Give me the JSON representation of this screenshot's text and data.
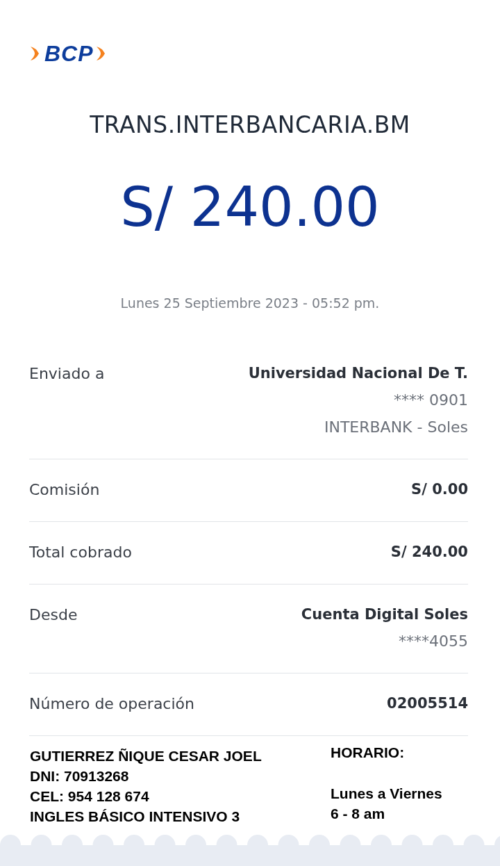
{
  "logo": {
    "text": "BCP"
  },
  "title": "TRANS.INTERBANCARIA.BM",
  "amount": "S/ 240.00",
  "datetime": "Lunes 25 Septiembre 2023 - 05:52 pm.",
  "details": [
    {
      "label": "Enviado a",
      "values": [
        "Universidad Nacional De T.",
        "**** 0901",
        "INTERBANK - Soles"
      ]
    },
    {
      "label": "Comisión",
      "values": [
        "S/ 0.00"
      ]
    },
    {
      "label": "Total cobrado",
      "values": [
        "S/ 240.00"
      ]
    },
    {
      "label": "Desde",
      "values": [
        "Cuenta Digital Soles",
        "****4055"
      ]
    },
    {
      "label": "Número de operación",
      "values": [
        "02005514"
      ]
    }
  ],
  "note": {
    "left": [
      "GUTIERREZ ÑIQUE CESAR JOEL",
      "DNI: 70913268",
      "CEL: 954 128 674",
      "INGLES BÁSICO INTENSIVO 3"
    ],
    "right_heading": "HORARIO:",
    "right": [
      "Lunes a Viernes",
      "6 - 8 am"
    ]
  }
}
